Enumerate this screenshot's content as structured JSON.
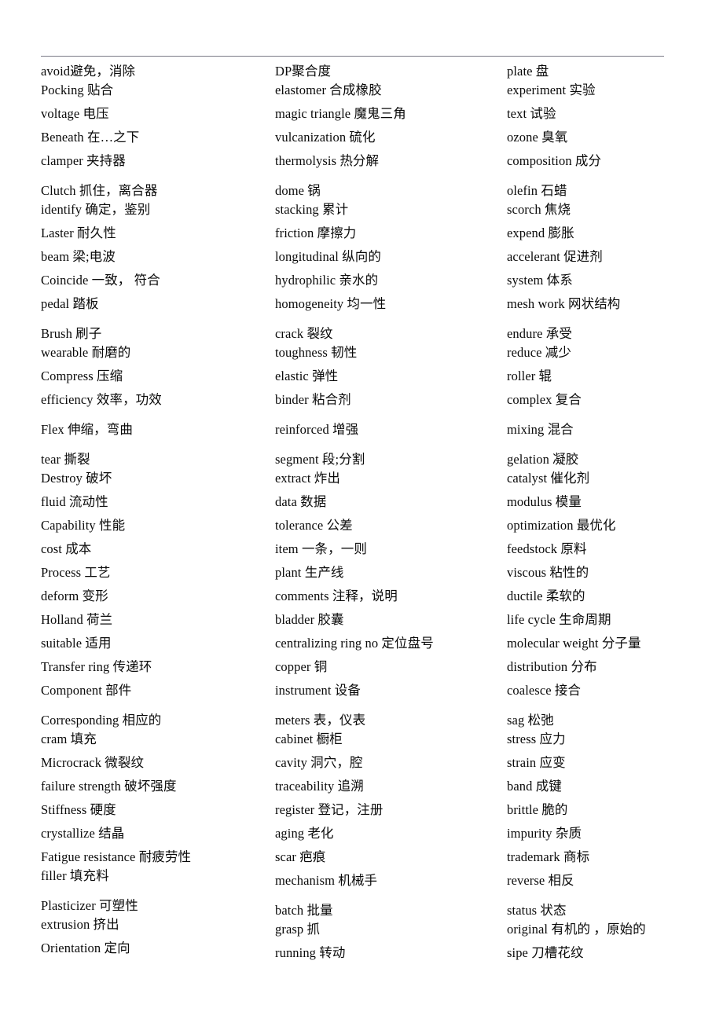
{
  "document": {
    "type": "glossary",
    "title_rule_visible": true,
    "columns_count": 3,
    "text_color": "#0a0a0a",
    "rule_color": "#7a7a86",
    "background": "#ffffff"
  },
  "columns": [
    {
      "id": "column-1",
      "entries": [
        {
          "text": "avoid避免，消除",
          "gap": "first"
        },
        {
          "text": "Pocking 贴合",
          "gap": "tight"
        },
        {
          "text": "voltage 电压",
          "gap": "norm"
        },
        {
          "text": "Beneath 在…之下",
          "gap": "norm"
        },
        {
          "text": "clamper 夹持器",
          "gap": "norm"
        },
        {
          "text": "Clutch 抓住，离合器",
          "gap": "wide"
        },
        {
          "text": "identify 确定，鉴别",
          "gap": "tight"
        },
        {
          "text": "Laster 耐久性",
          "gap": "norm"
        },
        {
          "text": "beam 梁;电波",
          "gap": "norm"
        },
        {
          "text": "Coincide 一致， 符合",
          "gap": "norm"
        },
        {
          "text": "pedal 踏板",
          "gap": "norm"
        },
        {
          "text": "Brush 刷子",
          "gap": "wide"
        },
        {
          "text": "wearable 耐磨的",
          "gap": "tight"
        },
        {
          "text": "Compress 压缩",
          "gap": "norm"
        },
        {
          "text": "efficiency 效率，功效",
          "gap": "norm"
        },
        {
          "text": "Flex 伸缩，弯曲",
          "gap": "wide"
        },
        {
          "text": "tear 撕裂",
          "gap": "wide"
        },
        {
          "text": "Destroy 破坏",
          "gap": "tight"
        },
        {
          "text": "fluid 流动性",
          "gap": "norm"
        },
        {
          "text": "Capability 性能",
          "gap": "norm"
        },
        {
          "text": "cost 成本",
          "gap": "norm"
        },
        {
          "text": "Process 工艺",
          "gap": "norm"
        },
        {
          "text": "deform 变形",
          "gap": "norm"
        },
        {
          "text": "Holland 荷兰",
          "gap": "norm"
        },
        {
          "text": "suitable 适用",
          "gap": "norm"
        },
        {
          "text": "Transfer ring 传递环",
          "gap": "norm"
        },
        {
          "text": "Component 部件",
          "gap": "norm"
        },
        {
          "text": "Corresponding 相应的",
          "gap": "wide"
        },
        {
          "text": "cram 填充",
          "gap": "tight"
        },
        {
          "text": "Microcrack 微裂纹",
          "gap": "norm"
        },
        {
          "text": "failure strength 破坏强度",
          "gap": "norm"
        },
        {
          "text": "Stiffness 硬度",
          "gap": "norm"
        },
        {
          "text": "crystallize 结晶",
          "gap": "norm"
        },
        {
          "text": "Fatigue resistance 耐疲劳性",
          "gap": "norm"
        },
        {
          "text": "filler 填充料",
          "gap": "tight"
        },
        {
          "text": "Plasticizer 可塑性",
          "gap": "wide"
        },
        {
          "text": "extrusion 挤出",
          "gap": "tight"
        },
        {
          "text": "Orientation 定向",
          "gap": "norm"
        }
      ]
    },
    {
      "id": "column-2",
      "entries": [
        {
          "text": "DP聚合度",
          "gap": "first"
        },
        {
          "text": "elastomer 合成橡胶",
          "gap": "tight"
        },
        {
          "text": "magic triangle 魔鬼三角",
          "gap": "norm"
        },
        {
          "text": "vulcanization 硫化",
          "gap": "norm"
        },
        {
          "text": "thermolysis 热分解",
          "gap": "norm"
        },
        {
          "text": "dome 锅",
          "gap": "wide"
        },
        {
          "text": "stacking 累计",
          "gap": "tight"
        },
        {
          "text": "friction 摩擦力",
          "gap": "norm"
        },
        {
          "text": "longitudinal 纵向的",
          "gap": "norm"
        },
        {
          "text": "hydrophilic 亲水的",
          "gap": "norm"
        },
        {
          "text": "homogeneity 均一性",
          "gap": "norm"
        },
        {
          "text": "crack 裂纹",
          "gap": "wide"
        },
        {
          "text": "toughness 韧性",
          "gap": "tight"
        },
        {
          "text": "elastic 弹性",
          "gap": "norm"
        },
        {
          "text": "binder 粘合剂",
          "gap": "norm"
        },
        {
          "text": "reinforced 增强",
          "gap": "wide"
        },
        {
          "text": "segment 段;分割",
          "gap": "wide"
        },
        {
          "text": "extract 炸出",
          "gap": "tight"
        },
        {
          "text": "data 数据",
          "gap": "norm"
        },
        {
          "text": "tolerance 公差",
          "gap": "norm"
        },
        {
          "text": "item 一条，一则",
          "gap": "norm"
        },
        {
          "text": "plant 生产线",
          "gap": "norm"
        },
        {
          "text": "comments 注释，说明",
          "gap": "norm"
        },
        {
          "text": "bladder 胶囊",
          "gap": "norm"
        },
        {
          "text": "centralizing ring no 定位盘号",
          "gap": "norm"
        },
        {
          "text": "copper 铜",
          "gap": "norm"
        },
        {
          "text": "instrument 设备",
          "gap": "norm"
        },
        {
          "text": "meters 表，仪表",
          "gap": "wide"
        },
        {
          "text": "cabinet 橱柜",
          "gap": "tight"
        },
        {
          "text": "cavity 洞穴，腔",
          "gap": "norm"
        },
        {
          "text": "traceability 追溯",
          "gap": "norm"
        },
        {
          "text": "register 登记，注册",
          "gap": "norm"
        },
        {
          "text": "aging 老化",
          "gap": "norm"
        },
        {
          "text": "scar 疤痕",
          "gap": "norm"
        },
        {
          "text": "mechanism 机械手",
          "gap": "norm"
        },
        {
          "text": "batch 批量",
          "gap": "wide"
        },
        {
          "text": "grasp 抓",
          "gap": "tight"
        },
        {
          "text": "running 转动",
          "gap": "norm"
        }
      ]
    },
    {
      "id": "column-3",
      "entries": [
        {
          "text": "plate 盘",
          "gap": "first"
        },
        {
          "text": "experiment 实验",
          "gap": "tight"
        },
        {
          "text": "text 试验",
          "gap": "norm"
        },
        {
          "text": "ozone 臭氧",
          "gap": "norm"
        },
        {
          "text": "composition 成分",
          "gap": "norm"
        },
        {
          "text": "olefin 石蜡",
          "gap": "wide"
        },
        {
          "text": "scorch 焦烧",
          "gap": "tight"
        },
        {
          "text": "expend 膨胀",
          "gap": "norm"
        },
        {
          "text": "accelerant 促进剂",
          "gap": "norm"
        },
        {
          "text": "system 体系",
          "gap": "norm"
        },
        {
          "text": "mesh work 网状结构",
          "gap": "norm"
        },
        {
          "text": "endure 承受",
          "gap": "wide"
        },
        {
          "text": "reduce 减少",
          "gap": "tight"
        },
        {
          "text": "roller 辊",
          "gap": "norm"
        },
        {
          "text": "complex 复合",
          "gap": "norm"
        },
        {
          "text": "mixing 混合",
          "gap": "wide"
        },
        {
          "text": "gelation 凝胶",
          "gap": "wide"
        },
        {
          "text": "catalyst 催化剂",
          "gap": "tight"
        },
        {
          "text": "modulus 模量",
          "gap": "norm"
        },
        {
          "text": "optimization 最优化",
          "gap": "norm"
        },
        {
          "text": "feedstock 原料",
          "gap": "norm"
        },
        {
          "text": "viscous 粘性的",
          "gap": "norm"
        },
        {
          "text": "ductile 柔软的",
          "gap": "norm"
        },
        {
          "text": "life cycle 生命周期",
          "gap": "norm"
        },
        {
          "text": "molecular weight 分子量",
          "gap": "norm"
        },
        {
          "text": "distribution 分布",
          "gap": "norm"
        },
        {
          "text": "coalesce 接合",
          "gap": "norm"
        },
        {
          "text": "sag 松弛",
          "gap": "wide"
        },
        {
          "text": "stress 应力",
          "gap": "tight"
        },
        {
          "text": "strain 应变",
          "gap": "norm"
        },
        {
          "text": "band 成键",
          "gap": "norm"
        },
        {
          "text": "brittle 脆的",
          "gap": "norm"
        },
        {
          "text": "impurity 杂质",
          "gap": "norm"
        },
        {
          "text": "trademark 商标",
          "gap": "norm"
        },
        {
          "text": "reverse 相反",
          "gap": "norm"
        },
        {
          "text": "status 状态",
          "gap": "wide"
        },
        {
          "text": "original 有机的 ，原始的",
          "gap": "tight"
        },
        {
          "text": "sipe 刀槽花纹",
          "gap": "norm"
        }
      ]
    }
  ]
}
